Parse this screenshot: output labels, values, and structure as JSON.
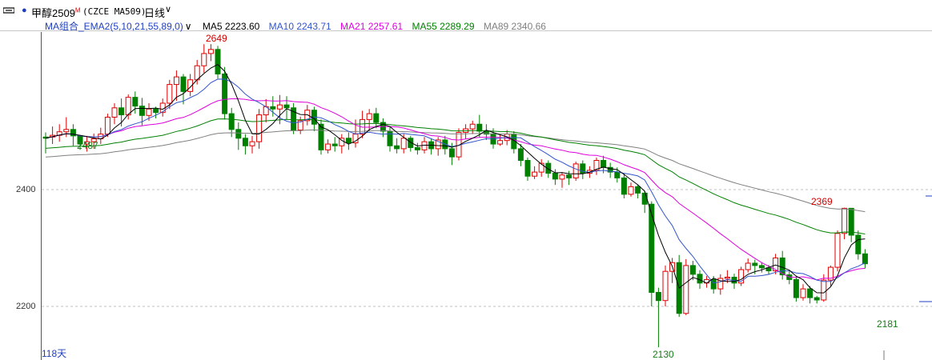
{
  "header": {
    "title": "甲醇2509",
    "title_sup": "M",
    "code": "(CZCE MA509)",
    "period": "日线"
  },
  "legend": {
    "group_label": "MA组合_EMA2(5,10,21,55,89,0)",
    "items": [
      {
        "label": "MA5 2223.60",
        "color": "#000000"
      },
      {
        "label": "MA10 2243.71",
        "color": "#3355cc"
      },
      {
        "label": "MA21 2257.61",
        "color": "#dd00dd"
      },
      {
        "label": "MA55 2289.29",
        "color": "#008000"
      },
      {
        "label": "MA89 2340.66",
        "color": "#808080"
      }
    ]
  },
  "axis": {
    "ticks": [
      "2400",
      "2200"
    ]
  },
  "annotations": {
    "high_first": "2649",
    "low_first": "2487",
    "high_second": "2369",
    "low_min": "2130",
    "last_low": "2181"
  },
  "footer": {
    "days": "118天"
  },
  "chart_data": {
    "type": "candlestick",
    "y_ticks": [
      2400,
      2200
    ],
    "up_color": "#e00000",
    "down_color": "#008000",
    "candles": [
      [
        2490,
        2488,
        2462,
        2498
      ],
      [
        2490,
        2493,
        2478,
        2508
      ],
      [
        2493,
        2499,
        2482,
        2512
      ],
      [
        2499,
        2503,
        2490,
        2524
      ],
      [
        2503,
        2492,
        2475,
        2512
      ],
      [
        2492,
        2478,
        2468,
        2488
      ],
      [
        2478,
        2482,
        2465,
        2492
      ],
      [
        2482,
        2487,
        2470,
        2496
      ],
      [
        2487,
        2495,
        2478,
        2506
      ],
      [
        2495,
        2524,
        2490,
        2530
      ],
      [
        2524,
        2540,
        2512,
        2548
      ],
      [
        2540,
        2528,
        2508,
        2556
      ],
      [
        2528,
        2558,
        2520,
        2563
      ],
      [
        2558,
        2543,
        2530,
        2568
      ],
      [
        2543,
        2527,
        2510,
        2557
      ],
      [
        2527,
        2538,
        2518,
        2548
      ],
      [
        2538,
        2532,
        2522,
        2542
      ],
      [
        2532,
        2548,
        2525,
        2556
      ],
      [
        2548,
        2580,
        2538,
        2588
      ],
      [
        2580,
        2593,
        2552,
        2604
      ],
      [
        2593,
        2568,
        2546,
        2598
      ],
      [
        2568,
        2588,
        2560,
        2598
      ],
      [
        2588,
        2612,
        2580,
        2622
      ],
      [
        2612,
        2633,
        2600,
        2649
      ],
      [
        2633,
        2640,
        2620,
        2649
      ],
      [
        2640,
        2598,
        2590,
        2646
      ],
      [
        2598,
        2530,
        2520,
        2610
      ],
      [
        2530,
        2503,
        2490,
        2540
      ],
      [
        2503,
        2488,
        2468,
        2515
      ],
      [
        2488,
        2475,
        2460,
        2495
      ],
      [
        2475,
        2482,
        2462,
        2492
      ],
      [
        2482,
        2528,
        2470,
        2538
      ],
      [
        2528,
        2542,
        2515,
        2555
      ],
      [
        2542,
        2538,
        2525,
        2560
      ],
      [
        2538,
        2545,
        2512,
        2562
      ],
      [
        2545,
        2540,
        2520,
        2560
      ],
      [
        2540,
        2502,
        2495,
        2548
      ],
      [
        2502,
        2518,
        2495,
        2525
      ],
      [
        2518,
        2536,
        2510,
        2545
      ],
      [
        2536,
        2512,
        2500,
        2542
      ],
      [
        2512,
        2468,
        2460,
        2520
      ],
      [
        2468,
        2478,
        2462,
        2486
      ],
      [
        2478,
        2475,
        2465,
        2490
      ],
      [
        2475,
        2488,
        2462,
        2495
      ],
      [
        2488,
        2480,
        2468,
        2498
      ],
      [
        2480,
        2495,
        2472,
        2520
      ],
      [
        2495,
        2520,
        2488,
        2535
      ],
      [
        2520,
        2530,
        2500,
        2538
      ],
      [
        2530,
        2515,
        2505,
        2540
      ],
      [
        2515,
        2500,
        2490,
        2522
      ],
      [
        2500,
        2475,
        2465,
        2508
      ],
      [
        2475,
        2470,
        2462,
        2488
      ],
      [
        2470,
        2488,
        2462,
        2495
      ],
      [
        2488,
        2472,
        2465,
        2492
      ],
      [
        2472,
        2468,
        2460,
        2480
      ],
      [
        2468,
        2482,
        2462,
        2490
      ],
      [
        2482,
        2470,
        2460,
        2488
      ],
      [
        2470,
        2485,
        2458,
        2490
      ],
      [
        2485,
        2470,
        2460,
        2492
      ],
      [
        2470,
        2456,
        2442,
        2480
      ],
      [
        2456,
        2498,
        2450,
        2505
      ],
      [
        2498,
        2504,
        2486,
        2512
      ],
      [
        2504,
        2512,
        2495,
        2518
      ],
      [
        2512,
        2500,
        2490,
        2528
      ],
      [
        2500,
        2495,
        2485,
        2512
      ],
      [
        2495,
        2478,
        2470,
        2505
      ],
      [
        2478,
        2484,
        2475,
        2494
      ],
      [
        2484,
        2495,
        2476,
        2502
      ],
      [
        2495,
        2470,
        2462,
        2500
      ],
      [
        2470,
        2450,
        2440,
        2478
      ],
      [
        2450,
        2423,
        2415,
        2455
      ],
      [
        2423,
        2430,
        2418,
        2440
      ],
      [
        2430,
        2445,
        2422,
        2452
      ],
      [
        2445,
        2428,
        2420,
        2450
      ],
      [
        2428,
        2418,
        2408,
        2435
      ],
      [
        2418,
        2425,
        2403,
        2430
      ],
      [
        2425,
        2420,
        2408,
        2432
      ],
      [
        2420,
        2444,
        2415,
        2448
      ],
      [
        2444,
        2428,
        2418,
        2450
      ],
      [
        2428,
        2433,
        2420,
        2440
      ],
      [
        2433,
        2450,
        2425,
        2455
      ],
      [
        2450,
        2438,
        2428,
        2458
      ],
      [
        2438,
        2430,
        2420,
        2446
      ],
      [
        2430,
        2420,
        2412,
        2438
      ],
      [
        2420,
        2392,
        2385,
        2428
      ],
      [
        2392,
        2405,
        2388,
        2412
      ],
      [
        2405,
        2394,
        2385,
        2408
      ],
      [
        2394,
        2375,
        2360,
        2398
      ],
      [
        2375,
        2224,
        2200,
        2380
      ],
      [
        2224,
        2210,
        2130,
        2232
      ],
      [
        2210,
        2260,
        2200,
        2270
      ],
      [
        2260,
        2275,
        2240,
        2283
      ],
      [
        2275,
        2188,
        2182,
        2288
      ],
      [
        2188,
        2270,
        2185,
        2281
      ],
      [
        2270,
        2255,
        2245,
        2278
      ],
      [
        2255,
        2240,
        2230,
        2262
      ],
      [
        2240,
        2246,
        2232,
        2252
      ],
      [
        2246,
        2230,
        2222,
        2252
      ],
      [
        2230,
        2248,
        2220,
        2255
      ],
      [
        2248,
        2250,
        2240,
        2262
      ],
      [
        2250,
        2240,
        2230,
        2256
      ],
      [
        2240,
        2263,
        2235,
        2268
      ],
      [
        2263,
        2274,
        2258,
        2282
      ],
      [
        2274,
        2270,
        2255,
        2280
      ],
      [
        2270,
        2266,
        2258,
        2275
      ],
      [
        2266,
        2261,
        2255,
        2271
      ],
      [
        2261,
        2283,
        2255,
        2290
      ],
      [
        2283,
        2254,
        2246,
        2295
      ],
      [
        2254,
        2246,
        2238,
        2260
      ],
      [
        2246,
        2215,
        2208,
        2252
      ],
      [
        2215,
        2230,
        2210,
        2238
      ],
      [
        2230,
        2215,
        2205,
        2235
      ],
      [
        2215,
        2211,
        2205,
        2218
      ],
      [
        2211,
        2245,
        2208,
        2255
      ],
      [
        2245,
        2267,
        2235,
        2270
      ],
      [
        2267,
        2325,
        2260,
        2330
      ],
      [
        2325,
        2368,
        2315,
        2369
      ],
      [
        2368,
        2322,
        2310,
        2368
      ],
      [
        2322,
        2290,
        2280,
        2330
      ],
      [
        2290,
        2273,
        2265,
        2298
      ]
    ]
  }
}
